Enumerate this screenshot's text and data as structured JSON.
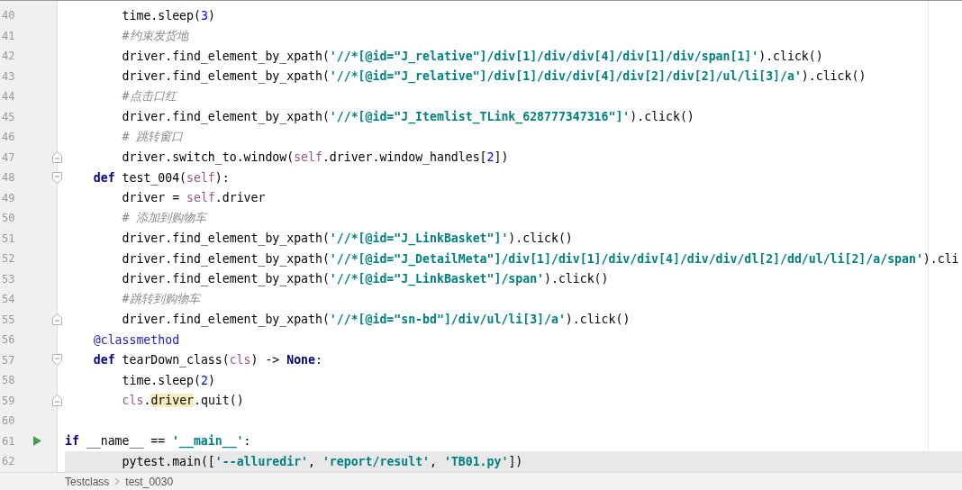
{
  "editor": {
    "lines": [
      {
        "number": "40",
        "kind": "body",
        "current": false,
        "tokens": [
          {
            "kind": "plain",
            "text": "time.sleep("
          },
          {
            "kind": "number",
            "text": "3"
          },
          {
            "kind": "plain",
            "text": ")"
          }
        ]
      },
      {
        "number": "41",
        "kind": "body",
        "current": false,
        "tokens": [
          {
            "kind": "comment",
            "text": "#约束发货地"
          }
        ]
      },
      {
        "number": "42",
        "kind": "body",
        "current": false,
        "tokens": [
          {
            "kind": "plain",
            "text": "driver.find_element_by_xpath("
          },
          {
            "kind": "string",
            "text": "'//*[@id=\"J_relative\"]/div[1]/div/div[4]/div[1]/div/span[1]'"
          },
          {
            "kind": "plain",
            "text": ").click()"
          }
        ]
      },
      {
        "number": "43",
        "kind": "body",
        "current": false,
        "tokens": [
          {
            "kind": "plain",
            "text": "driver.find_element_by_xpath("
          },
          {
            "kind": "string",
            "text": "'//*[@id=\"J_relative\"]/div[1]/div/div[4]/div[2]/div[2]/ul/li[3]/a'"
          },
          {
            "kind": "plain",
            "text": ").click()"
          }
        ]
      },
      {
        "number": "44",
        "kind": "body",
        "current": false,
        "tokens": [
          {
            "kind": "comment",
            "text": "#点击口红"
          }
        ]
      },
      {
        "number": "45",
        "kind": "body",
        "current": false,
        "tokens": [
          {
            "kind": "plain",
            "text": "driver.find_element_by_xpath("
          },
          {
            "kind": "string",
            "text": "'//*[@id=\"J_Itemlist_TLink_628777347316\"]'"
          },
          {
            "kind": "plain",
            "text": ").click()"
          }
        ]
      },
      {
        "number": "46",
        "kind": "body",
        "current": false,
        "tokens": [
          {
            "kind": "comment",
            "text": "# 跳转窗口"
          }
        ]
      },
      {
        "number": "47",
        "kind": "body",
        "current": false,
        "gutter": {
          "kind": "fold-end"
        },
        "tokens": [
          {
            "kind": "plain",
            "text": "driver.switch_to.window("
          },
          {
            "kind": "self",
            "text": "self"
          },
          {
            "kind": "plain",
            "text": ".driver.window_handles["
          },
          {
            "kind": "number",
            "text": "2"
          },
          {
            "kind": "plain",
            "text": "])"
          }
        ]
      },
      {
        "number": "48",
        "kind": "member",
        "current": false,
        "gutter": {
          "kind": "fold-start"
        },
        "tokens": [
          {
            "kind": "keyword",
            "text": "def"
          },
          {
            "kind": "plain",
            "text": " test_004("
          },
          {
            "kind": "self",
            "text": "self"
          },
          {
            "kind": "plain",
            "text": "):"
          }
        ]
      },
      {
        "number": "49",
        "kind": "body",
        "current": false,
        "tokens": [
          {
            "kind": "plain",
            "text": "driver = "
          },
          {
            "kind": "self",
            "text": "self"
          },
          {
            "kind": "plain",
            "text": ".driver"
          }
        ]
      },
      {
        "number": "50",
        "kind": "body",
        "current": false,
        "tokens": [
          {
            "kind": "comment",
            "text": "# 添加到购物车"
          }
        ]
      },
      {
        "number": "51",
        "kind": "body",
        "current": false,
        "tokens": [
          {
            "kind": "plain",
            "text": "driver.find_element_by_xpath("
          },
          {
            "kind": "string",
            "text": "'//*[@id=\"J_LinkBasket\"]'"
          },
          {
            "kind": "plain",
            "text": ").click()"
          }
        ]
      },
      {
        "number": "52",
        "kind": "body",
        "current": false,
        "tokens": [
          {
            "kind": "plain",
            "text": "driver.find_element_by_xpath("
          },
          {
            "kind": "string",
            "text": "'//*[@id=\"J_DetailMeta\"]/div[1]/div[1]/div/div[4]/div/div/dl[2]/dd/ul/li[2]/a/span'"
          },
          {
            "kind": "plain",
            "text": ").cli"
          }
        ]
      },
      {
        "number": "53",
        "kind": "body",
        "current": false,
        "tokens": [
          {
            "kind": "plain",
            "text": "driver.find_element_by_xpath("
          },
          {
            "kind": "string",
            "text": "'//*[@id=\"J_LinkBasket\"]/span'"
          },
          {
            "kind": "plain",
            "text": ").click()"
          }
        ]
      },
      {
        "number": "54",
        "kind": "body",
        "current": false,
        "tokens": [
          {
            "kind": "comment",
            "text": "#跳转到购物车"
          }
        ]
      },
      {
        "number": "55",
        "kind": "body",
        "current": false,
        "gutter": {
          "kind": "fold-end"
        },
        "tokens": [
          {
            "kind": "plain",
            "text": "driver.find_element_by_xpath("
          },
          {
            "kind": "string",
            "text": "'//*[@id=\"sn-bd\"]/div/ul/li[3]/a'"
          },
          {
            "kind": "plain",
            "text": ").click()"
          }
        ]
      },
      {
        "number": "56",
        "kind": "member",
        "current": false,
        "tokens": [
          {
            "kind": "decorator",
            "text": "@classmethod"
          }
        ]
      },
      {
        "number": "57",
        "kind": "member",
        "current": false,
        "gutter": {
          "kind": "fold-start"
        },
        "tokens": [
          {
            "kind": "keyword",
            "text": "def"
          },
          {
            "kind": "plain",
            "text": " tearDown_class("
          },
          {
            "kind": "self",
            "text": "cls"
          },
          {
            "kind": "plain",
            "text": ") -> "
          },
          {
            "kind": "keyword",
            "text": "None"
          },
          {
            "kind": "plain",
            "text": ":"
          }
        ]
      },
      {
        "number": "58",
        "kind": "body",
        "current": false,
        "tokens": [
          {
            "kind": "plain",
            "text": "time.sleep("
          },
          {
            "kind": "number",
            "text": "2"
          },
          {
            "kind": "plain",
            "text": ")"
          }
        ]
      },
      {
        "number": "59",
        "kind": "body",
        "current": false,
        "gutter": {
          "kind": "fold-end"
        },
        "tokens": [
          {
            "kind": "self",
            "text": "cls"
          },
          {
            "kind": "plain",
            "text": "."
          },
          {
            "kind": "highlight",
            "text": "driver"
          },
          {
            "kind": "plain",
            "text": ".quit()"
          }
        ]
      },
      {
        "number": "60",
        "kind": "top",
        "current": false
      },
      {
        "number": "61",
        "kind": "top",
        "current": false,
        "gutter": {
          "kind": "run"
        },
        "tokens": [
          {
            "kind": "keyword",
            "text": "if"
          },
          {
            "kind": "plain",
            "text": " __name__ == "
          },
          {
            "kind": "string",
            "text": "'__main__'"
          },
          {
            "kind": "plain",
            "text": ":"
          }
        ]
      },
      {
        "number": "62",
        "kind": "body",
        "current": true,
        "tokens": [
          {
            "kind": "plain",
            "text": "pytest.main(["
          },
          {
            "kind": "string",
            "text": "'--alluredir'"
          },
          {
            "kind": "plain",
            "text": ", "
          },
          {
            "kind": "string",
            "text": "'report/result'"
          },
          {
            "kind": "plain",
            "text": ", "
          },
          {
            "kind": "string",
            "text": "'TB01.py'"
          },
          {
            "kind": "plain",
            "text": "])"
          }
        ]
      }
    ]
  },
  "breadcrumb": [
    "Testclass",
    "test_0030"
  ]
}
